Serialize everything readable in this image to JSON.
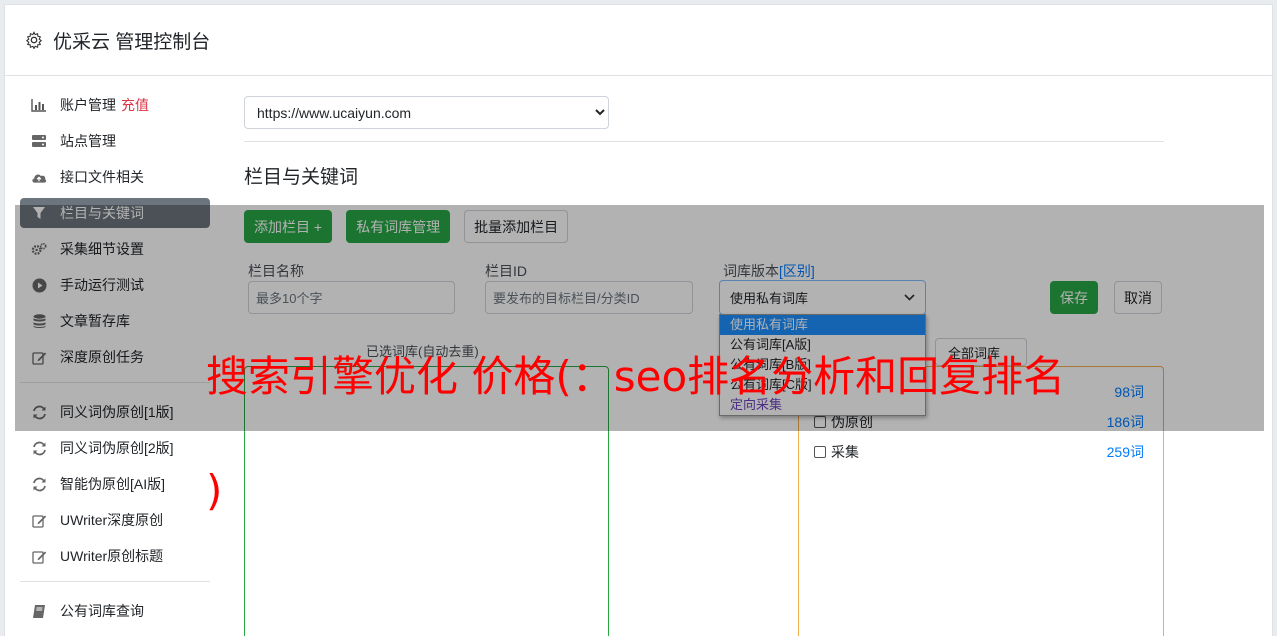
{
  "header": {
    "title": "优采云 管理控制台",
    "icon": "gear-icon"
  },
  "sidebar": {
    "items": [
      {
        "label": "账户管理",
        "extra": "充值",
        "icon": "bar-chart-icon"
      },
      {
        "label": "站点管理",
        "icon": "server-icon"
      },
      {
        "label": "接口文件相关",
        "icon": "cloud-upload-icon"
      },
      {
        "label": "栏目与关键词",
        "icon": "filter-icon",
        "active": true
      },
      {
        "label": "采集细节设置",
        "icon": "cogs-icon"
      },
      {
        "label": "手动运行测试",
        "icon": "play-circle-icon"
      },
      {
        "label": "文章暂存库",
        "icon": "database-icon"
      },
      {
        "label": "深度原创任务",
        "icon": "edit-icon"
      },
      {
        "label": "同义词伪原创[1版]",
        "icon": "refresh-icon"
      },
      {
        "label": "同义词伪原创[2版]",
        "icon": "refresh-icon"
      },
      {
        "label": "智能伪原创[AI版]",
        "icon": "refresh-icon"
      },
      {
        "label": "UWriter深度原创",
        "icon": "edit-icon"
      },
      {
        "label": "UWriter原创标题",
        "icon": "edit-icon"
      },
      {
        "label": "公有词库查询",
        "icon": "book-icon"
      }
    ]
  },
  "main": {
    "site_select": "https://www.ucaiyun.com",
    "section_title": "栏目与关键词",
    "buttons": {
      "add_column": "添加栏目 +",
      "private_lib": "私有词库管理",
      "batch_add": "批量添加栏目"
    },
    "form": {
      "column_name_label": "栏目名称",
      "column_name_placeholder": "最多10个字",
      "column_id_label": "栏目ID",
      "column_id_placeholder": "要发布的目标栏目/分类ID",
      "lib_version_label": "词库版本",
      "lib_version_link": "[区别]",
      "lib_version_value": "使用私有词库",
      "save": "保存",
      "cancel": "取消"
    },
    "dropdown_options": [
      "使用私有词库",
      "公有词库[A版]",
      "公有词库[B版]",
      "公有词库[C版]",
      "定向采集"
    ],
    "selected_caption": "已选词库(自动去重)",
    "all_libs_button": "全部词库",
    "libraries": [
      {
        "name": "",
        "count": "98词"
      },
      {
        "name": "伪原创",
        "count": "186词"
      },
      {
        "name": "采集",
        "count": "259词"
      }
    ]
  },
  "watermark": {
    "line1": "搜索引擎优化 价格(：seo排名分析和回复排名",
    "line2": ")"
  },
  "colors": {
    "active_nav": "#6c757d",
    "green": "#28a745",
    "danger": "#dc3545",
    "link": "#007bff",
    "watermark": "#ff0000"
  }
}
